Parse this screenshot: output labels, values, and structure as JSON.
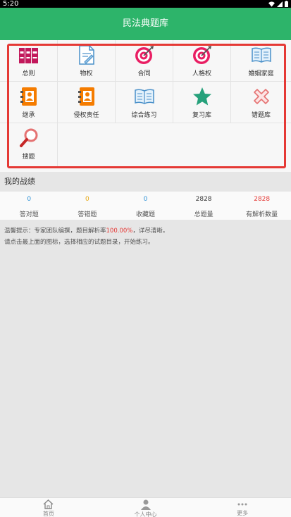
{
  "status_bar": {
    "time": "5:20"
  },
  "app_bar": {
    "title": "民法典题库"
  },
  "grid": {
    "items": [
      {
        "label": "总则",
        "icon": "books-icon"
      },
      {
        "label": "物权",
        "icon": "document-pen-icon"
      },
      {
        "label": "合同",
        "icon": "target-icon"
      },
      {
        "label": "人格权",
        "icon": "target-icon"
      },
      {
        "label": "婚姻家庭",
        "icon": "open-book-icon"
      },
      {
        "label": "继承",
        "icon": "contact-book-icon"
      },
      {
        "label": "侵权责任",
        "icon": "contact-book-icon"
      },
      {
        "label": "综合练习",
        "icon": "open-book-icon"
      },
      {
        "label": "复习库",
        "icon": "star-icon"
      },
      {
        "label": "错题库",
        "icon": "cross-icon"
      },
      {
        "label": "搜题",
        "icon": "search-icon"
      }
    ]
  },
  "stats": {
    "title": "我的战绩",
    "items": [
      {
        "value": "0",
        "label": "答对题",
        "color": "#2a8fd6"
      },
      {
        "value": "0",
        "label": "答错题",
        "color": "#e6a817"
      },
      {
        "value": "0",
        "label": "收藏题",
        "color": "#2a8fd6"
      },
      {
        "value": "2828",
        "label": "总题量",
        "color": "#333333"
      },
      {
        "value": "2828",
        "label": "有解析数量",
        "color": "#e53935"
      }
    ]
  },
  "tip": {
    "line1_prefix": "温馨提示：专家团队编撰，题目解析率",
    "line1_pct": "100.00%",
    "line1_suffix": "，详尽清晰。",
    "line2": "请点击最上面的图标，选择相应的试题目录，开始练习。"
  },
  "bottom_nav": {
    "items": [
      {
        "label": "首页",
        "icon": "home-icon"
      },
      {
        "label": "个人中心",
        "icon": "person-icon"
      },
      {
        "label": "更多",
        "icon": "more-dots-icon"
      }
    ]
  },
  "colors": {
    "accent": "#2db46a",
    "highlight_border": "#e53935"
  }
}
